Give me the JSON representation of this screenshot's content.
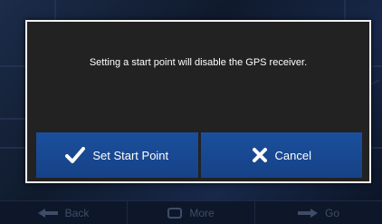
{
  "dialog": {
    "message": "Setting a start point will disable the GPS receiver.",
    "confirm_label": "Set Start Point",
    "confirm_icon": "checkmark-icon",
    "cancel_label": "Cancel",
    "cancel_icon": "x-icon"
  },
  "bottom_bar": {
    "back_label": "Back",
    "back_icon": "arrow-left-icon",
    "more_label": "More",
    "more_icon": "more-icon",
    "go_label": "Go",
    "go_icon": "arrow-right-icon"
  },
  "colors": {
    "dialog_bg": "#222222",
    "dialog_border": "#f2f2f2",
    "button_blue": "#1b4f9c",
    "bottom_bar_text": "#3e4c68"
  }
}
